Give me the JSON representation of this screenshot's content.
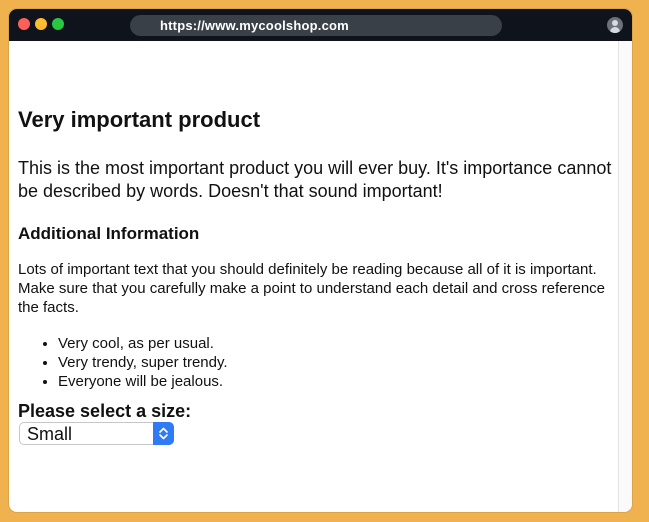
{
  "browser": {
    "url": "https://www.mycoolshop.com",
    "icons": {
      "close": "close-dot-icon",
      "minimize": "minimize-dot-icon",
      "maximize": "maximize-dot-icon",
      "profile": "user-avatar-icon"
    },
    "colors": {
      "titlebar": "#0f131b",
      "urlbar": "#394047",
      "close": "#fe5f57",
      "minimize": "#febc2e",
      "maximize": "#28c840"
    }
  },
  "page": {
    "title": "Very important product",
    "intro": "This is the most important product you will ever buy. It's importance cannot be described by words. Doesn't that sound important!",
    "additional_heading": "Additional Information",
    "details": "Lots of important text that you should definitely be reading because all of it is important. Make sure that you carefully make a point to understand each detail and cross reference the facts.",
    "features": [
      "Very cool, as per usual.",
      "Very trendy, super trendy.",
      "Everyone will be jealous."
    ],
    "size_label": "Please select a size:",
    "size_select": {
      "selected": "Small",
      "icon": "chevron-up-down-icon"
    }
  },
  "theme": {
    "background": "#efb24f",
    "select_accent": "#2f7bf6"
  }
}
